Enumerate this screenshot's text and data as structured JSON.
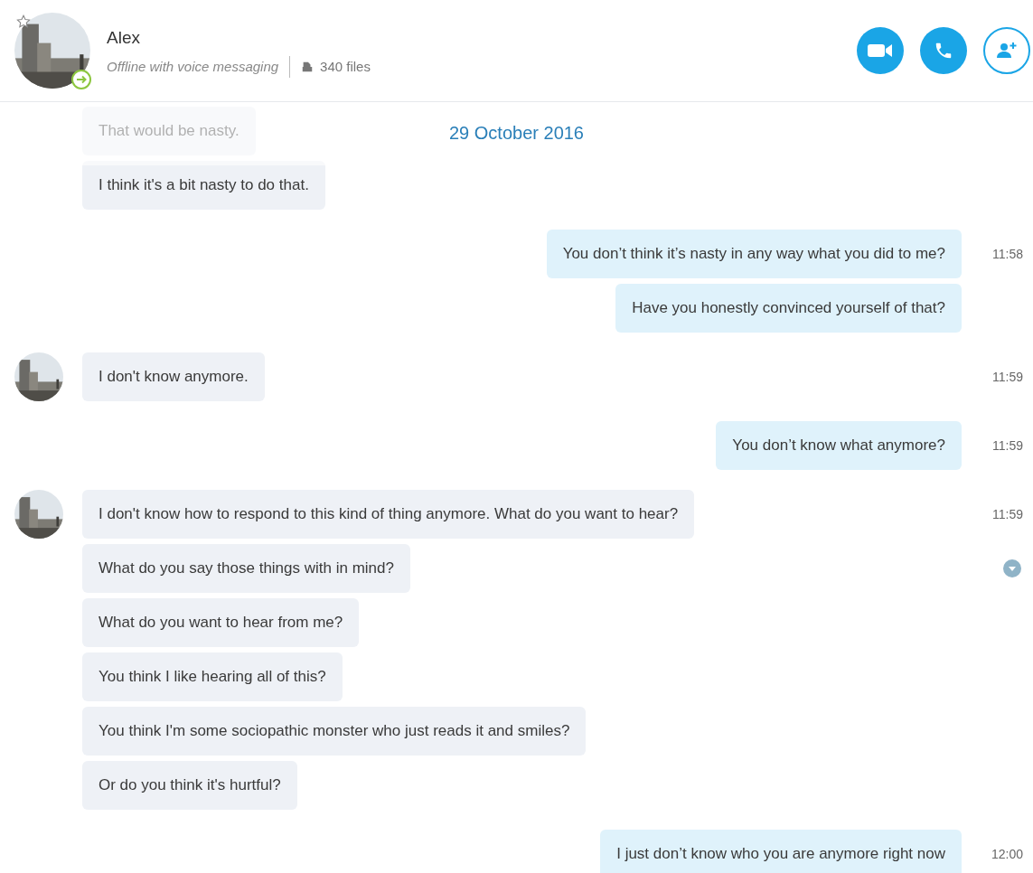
{
  "contact": {
    "name": "Alex",
    "status": "Offline with voice messaging",
    "files": "340 files"
  },
  "date_banner": "29 October 2016",
  "groups": [
    {
      "kind": "incoming",
      "avatar": false,
      "messages": [
        {
          "text": "That would be nasty.",
          "hovered": false
        },
        {
          "text": "I think it's a bit nasty to do that.",
          "hovered": false
        }
      ]
    },
    {
      "kind": "outgoing",
      "avatar": false,
      "messages": [
        {
          "text": "You don’t think it’s nasty in any way what you did to me?",
          "time": "11:58",
          "hovered": false
        },
        {
          "text": "Have you honestly convinced yourself of that?",
          "hovered": false
        }
      ]
    },
    {
      "kind": "incoming",
      "avatar": true,
      "messages": [
        {
          "text": "I don't know anymore.",
          "time": "11:59",
          "hovered": false
        }
      ]
    },
    {
      "kind": "outgoing",
      "avatar": false,
      "messages": [
        {
          "text": "You don’t know what anymore?",
          "time": "11:59",
          "hovered": false
        }
      ]
    },
    {
      "kind": "incoming",
      "avatar": true,
      "messages": [
        {
          "text": "I don't know how to respond to this kind of thing anymore. What do you want to hear?",
          "time": "11:59",
          "hovered": false
        },
        {
          "text": "What do you say those things with in mind?",
          "hovered": true
        },
        {
          "text": "What do you want to hear from me?",
          "hovered": false
        },
        {
          "text": "You think I like hearing all of this?",
          "hovered": false
        },
        {
          "text": "You think I'm some sociopathic monster who just reads it and smiles?",
          "hovered": false
        },
        {
          "text": "Or do you think it's hurtful?",
          "hovered": false
        }
      ]
    },
    {
      "kind": "outgoing",
      "avatar": false,
      "messages": [
        {
          "text": "I just don’t know who you are anymore right now",
          "time": "12:00",
          "hovered": false
        }
      ]
    }
  ]
}
